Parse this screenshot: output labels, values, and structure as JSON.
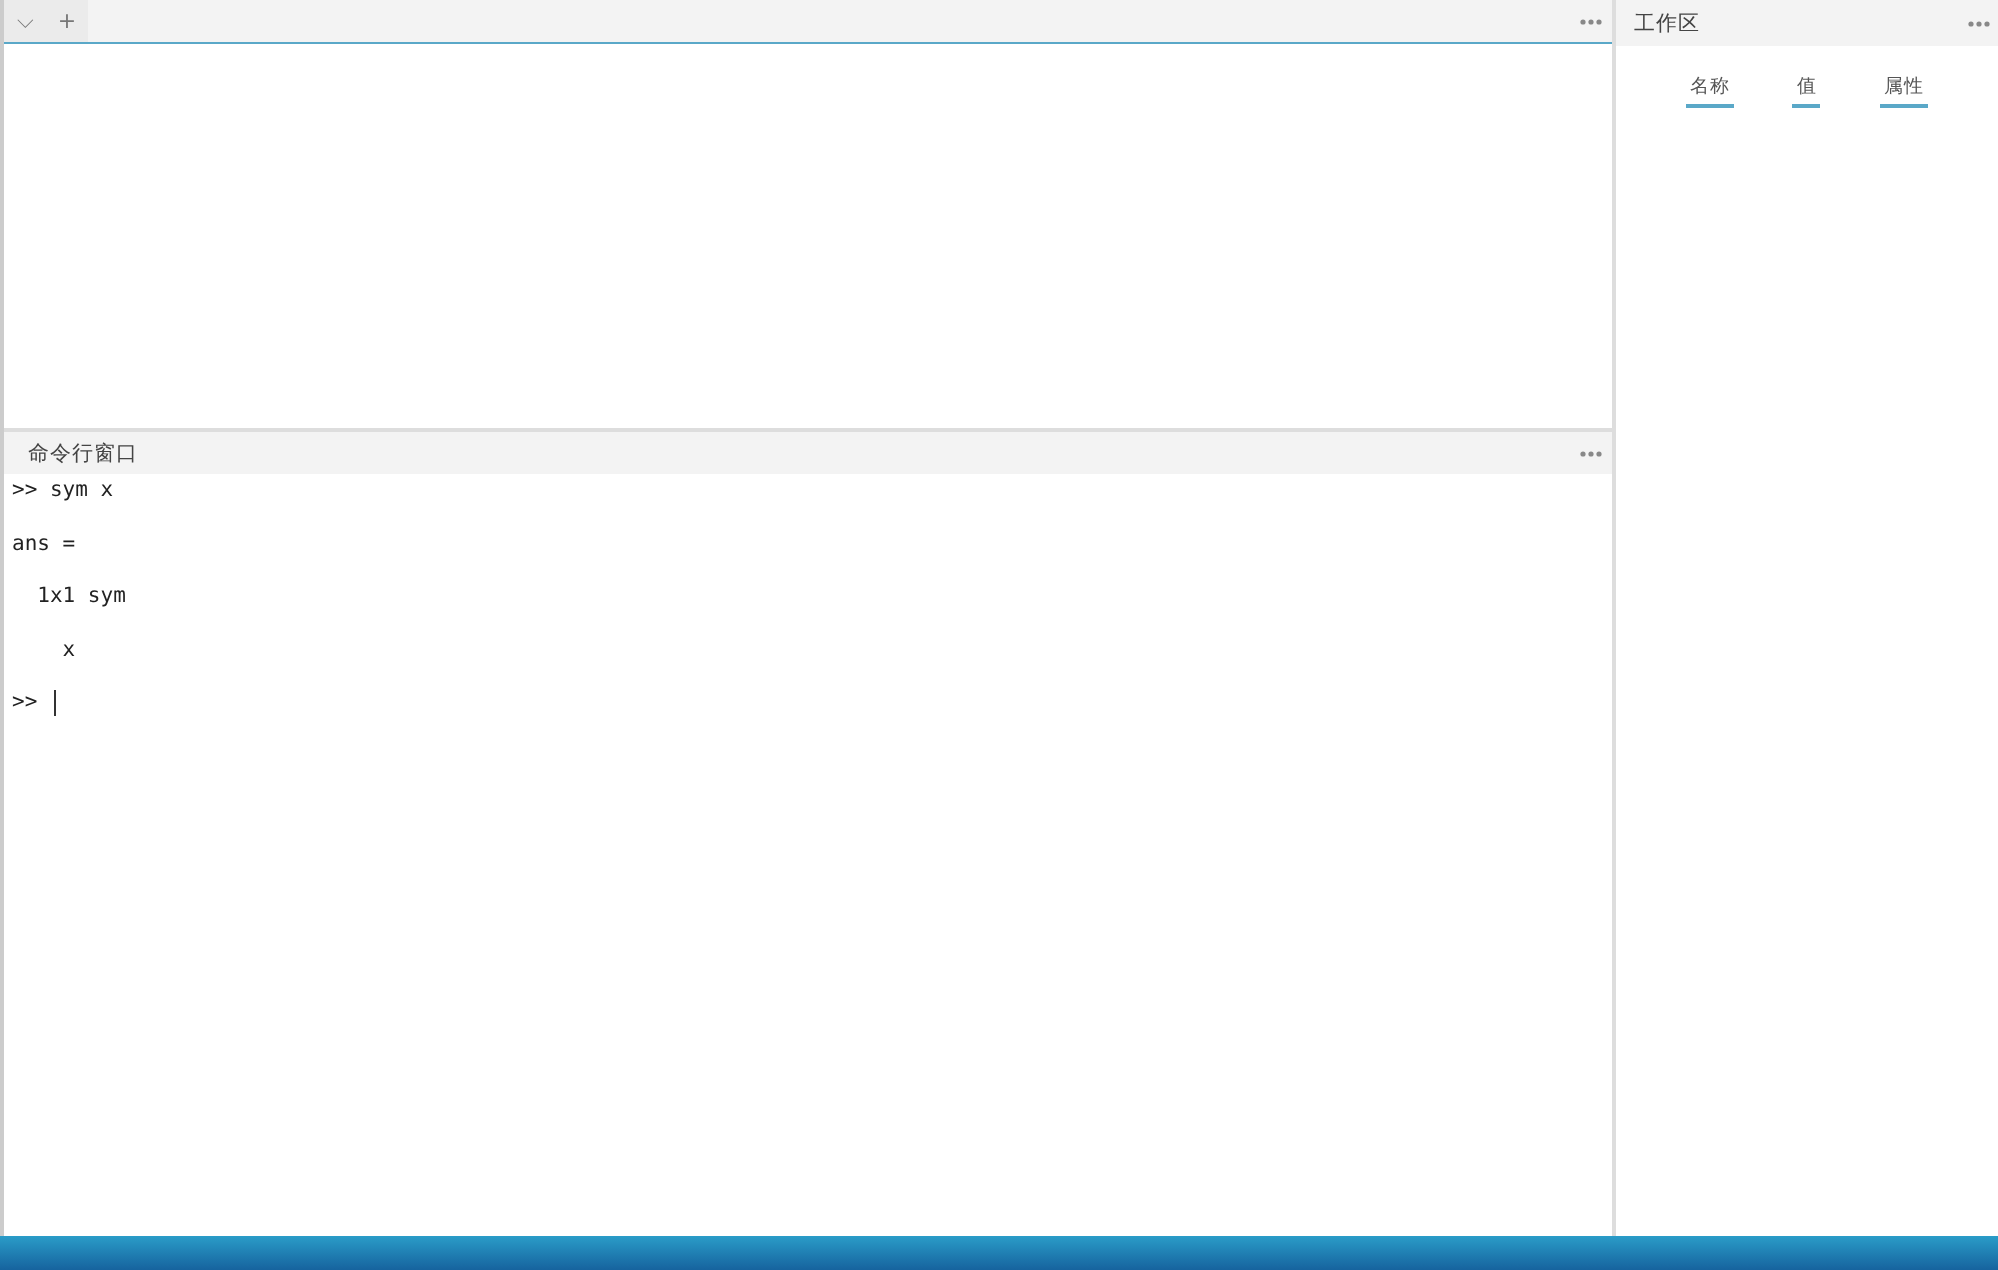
{
  "editor": {
    "tab_bar": {
      "dropdown": "⌵",
      "add": "+"
    }
  },
  "command_window": {
    "title": "命令行窗口",
    "lines": [
      {
        "kind": "output",
        "text": ">> sym x"
      },
      {
        "kind": "output",
        "text": "ans ="
      },
      {
        "kind": "output",
        "text": "  1x1 sym"
      },
      {
        "kind": "output",
        "text": "    x"
      },
      {
        "kind": "prompt",
        "text": ">>"
      }
    ]
  },
  "workspace": {
    "title": "工作区",
    "columns": [
      "名称",
      "值",
      "属性"
    ]
  }
}
